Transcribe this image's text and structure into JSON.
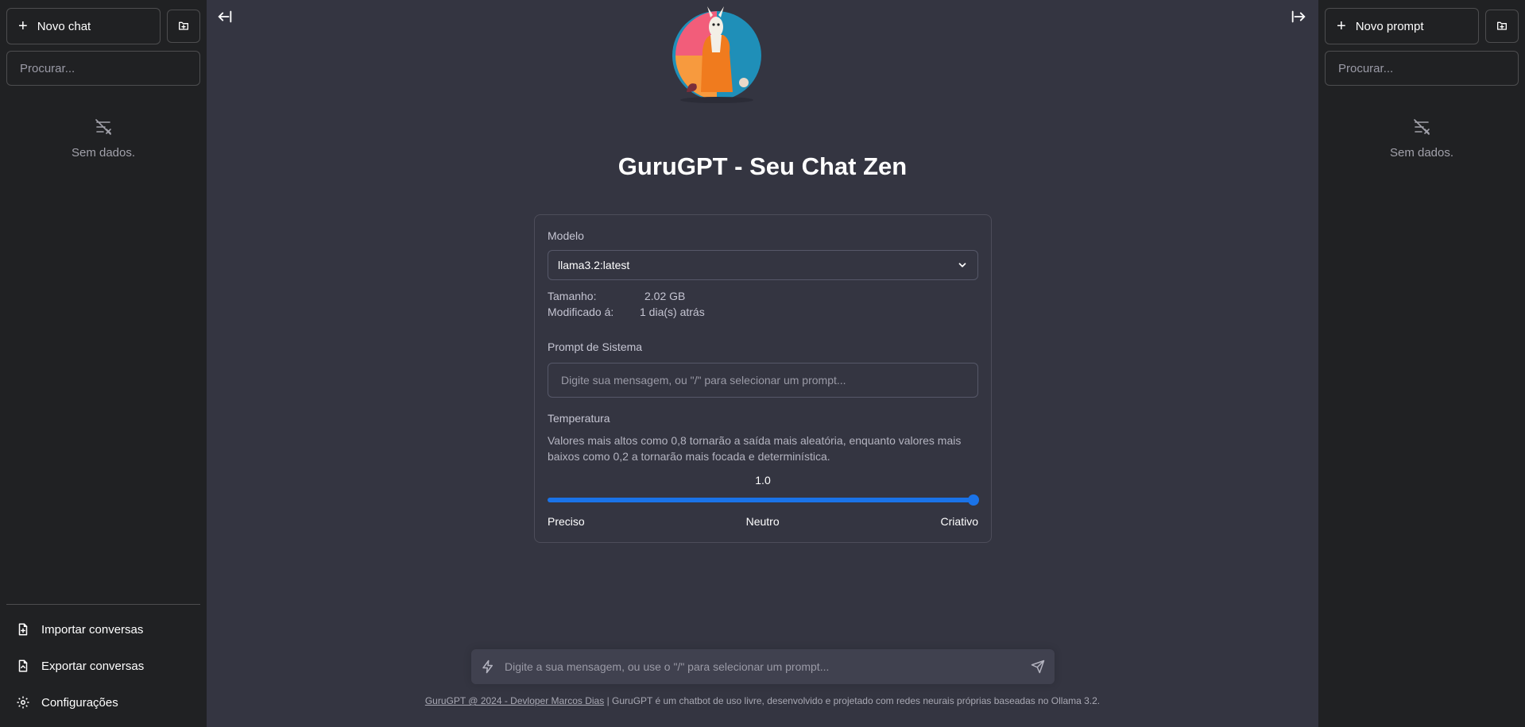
{
  "left_sidebar": {
    "new_chat_label": "Novo chat",
    "search_placeholder": "Procurar...",
    "empty_text": "Sem dados.",
    "bottom_items": [
      {
        "label": "Importar conversas",
        "icon": "file-import-icon"
      },
      {
        "label": "Exportar conversas",
        "icon": "file-export-icon"
      },
      {
        "label": "Configurações",
        "icon": "settings-gear-icon"
      }
    ]
  },
  "right_sidebar": {
    "new_prompt_label": "Novo prompt",
    "search_placeholder": "Procurar...",
    "empty_text": "Sem dados."
  },
  "main": {
    "title": "GuruGPT - Seu Chat Zen",
    "model_label": "Modelo",
    "model_selected": "llama3.2:latest",
    "size_key": "Tamanho:",
    "size_value": "2.02 GB",
    "modified_key": "Modificado á:",
    "modified_value": "1 dia(s) atrás",
    "system_prompt_label": "Prompt de Sistema",
    "system_prompt_placeholder": "Digite sua mensagem, ou \"/\" para selecionar um prompt...",
    "temperature_label": "Temperatura",
    "temperature_desc": "Valores mais altos como 0,8 tornarão a saída mais aleatória, enquanto valores mais baixos como 0,2 a tornarão mais focada e determinística.",
    "temperature_value": "1.0",
    "temperature_fraction": 1.0,
    "slider_left": "Preciso",
    "slider_mid": "Neutro",
    "slider_right": "Criativo"
  },
  "chat": {
    "placeholder": "Digite a sua mensagem, ou use o \"/\" para selecionar um prompt..."
  },
  "footer": {
    "link_text": "GuruGPT @ 2024 - Devloper Marcos Dias",
    "text": "| GuruGPT é um chatbot de uso livre, desenvolvido e projetado com redes neurais próprias baseadas no Ollama 3.2."
  },
  "colors": {
    "accent": "#1a73e8",
    "sidebar_bg": "#202123",
    "main_bg": "#343541"
  }
}
